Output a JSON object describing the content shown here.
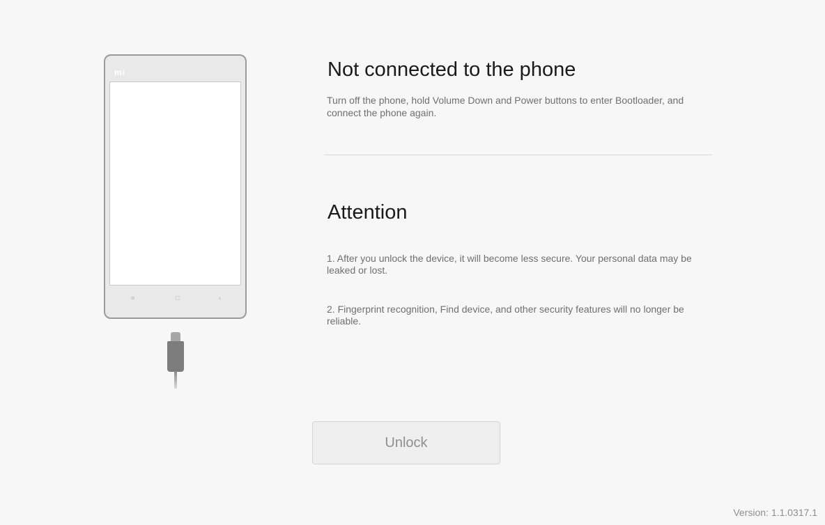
{
  "phone": {
    "logo": "mi",
    "keys": {
      "menu_icon": "≡",
      "home_icon": "□",
      "back_icon": "‹"
    }
  },
  "status": {
    "title": "Not connected to the phone",
    "description": "Turn off the phone, hold Volume Down and Power buttons to enter Bootloader, and connect the phone again."
  },
  "attention": {
    "title": "Attention",
    "items": [
      "1. After you unlock the device, it will become less secure. Your personal data may be leaked or lost.",
      "2. Fingerprint recognition, Find device, and other security features will no longer be reliable."
    ]
  },
  "unlock_button": {
    "label": "Unlock",
    "enabled": false
  },
  "version": "Version: 1.1.0317.1",
  "colors": {
    "background": "#f7f7f7",
    "title_text": "#1a1a1a",
    "body_text": "#6f6f6f",
    "button_background": "#efefef",
    "button_text": "#8f8f8f"
  }
}
